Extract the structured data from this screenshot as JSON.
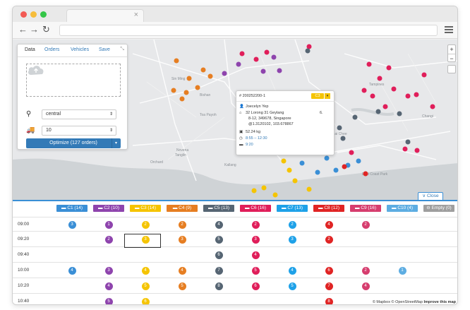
{
  "browser": {
    "tab_title": ""
  },
  "panel": {
    "tabs": [
      "Data",
      "Orders",
      "Vehicles",
      "Save"
    ],
    "depot": "central",
    "vehicles": "10",
    "optimize_label": "Optimize (127 orders)"
  },
  "map": {
    "zoom_in": "+",
    "zoom_out": "−"
  },
  "popup": {
    "order_id": "# 200252200-1",
    "badge": "C3",
    "name": "Joecelyn Yep",
    "address1": "32 Lorong 31 Geylang",
    "address2": "8-12, 349678, Singapore",
    "coords": "@1.3120102, 103.678867",
    "extra": "6.",
    "weight": "52.24 kg",
    "window": "8:55 – 12:30",
    "eta": "9:20"
  },
  "close_label": "Close",
  "schedule": {
    "columns": [
      {
        "label": "C1 (14)",
        "color": "#3a8fd6"
      },
      {
        "label": "C2 (10)",
        "color": "#8e44ad"
      },
      {
        "label": "C3 (14)",
        "color": "#f5c400"
      },
      {
        "label": "C4 (9)",
        "color": "#e67e22"
      },
      {
        "label": "C5 (13)",
        "color": "#566573"
      },
      {
        "label": "C6 (16)",
        "color": "#e01e5a"
      },
      {
        "label": "C7 (13)",
        "color": "#1ea1e8"
      },
      {
        "label": "C8 (12)",
        "color": "#e02424"
      },
      {
        "label": "C9 (16)",
        "color": "#d63d6e"
      },
      {
        "label": "C10 (4)",
        "color": "#5dade2"
      },
      {
        "label": "Empty (0)",
        "color": "#9e9e9e"
      }
    ],
    "rows": [
      {
        "time": "09:00",
        "cells": [
          "3",
          "1",
          "2",
          "2",
          "4",
          "2",
          "2",
          "4",
          "2",
          "",
          ""
        ]
      },
      {
        "time": "09:20",
        "cells": [
          "",
          "2",
          "3",
          "3",
          "5",
          "3",
          "3",
          "2",
          "",
          "",
          ""
        ]
      },
      {
        "time": "09:40",
        "cells": [
          "",
          "",
          "",
          "",
          "6",
          "4",
          "",
          "",
          "",
          "",
          ""
        ]
      },
      {
        "time": "10:00",
        "cells": [
          "4",
          "3",
          "4",
          "4",
          "7",
          "5",
          "4",
          "6",
          "2",
          "1",
          ""
        ]
      },
      {
        "time": "10:20",
        "cells": [
          "",
          "4",
          "5",
          "5",
          "8",
          "6",
          "5",
          "7",
          "4",
          "",
          ""
        ]
      },
      {
        "time": "10:40",
        "cells": [
          "",
          "5",
          "6",
          "",
          "",
          "",
          "",
          "8",
          "",
          "",
          ""
        ]
      }
    ]
  },
  "attribution": {
    "mapbox": "© Mapbox",
    "osm": "© OpenStreetMap",
    "improve": "Improve this map"
  }
}
